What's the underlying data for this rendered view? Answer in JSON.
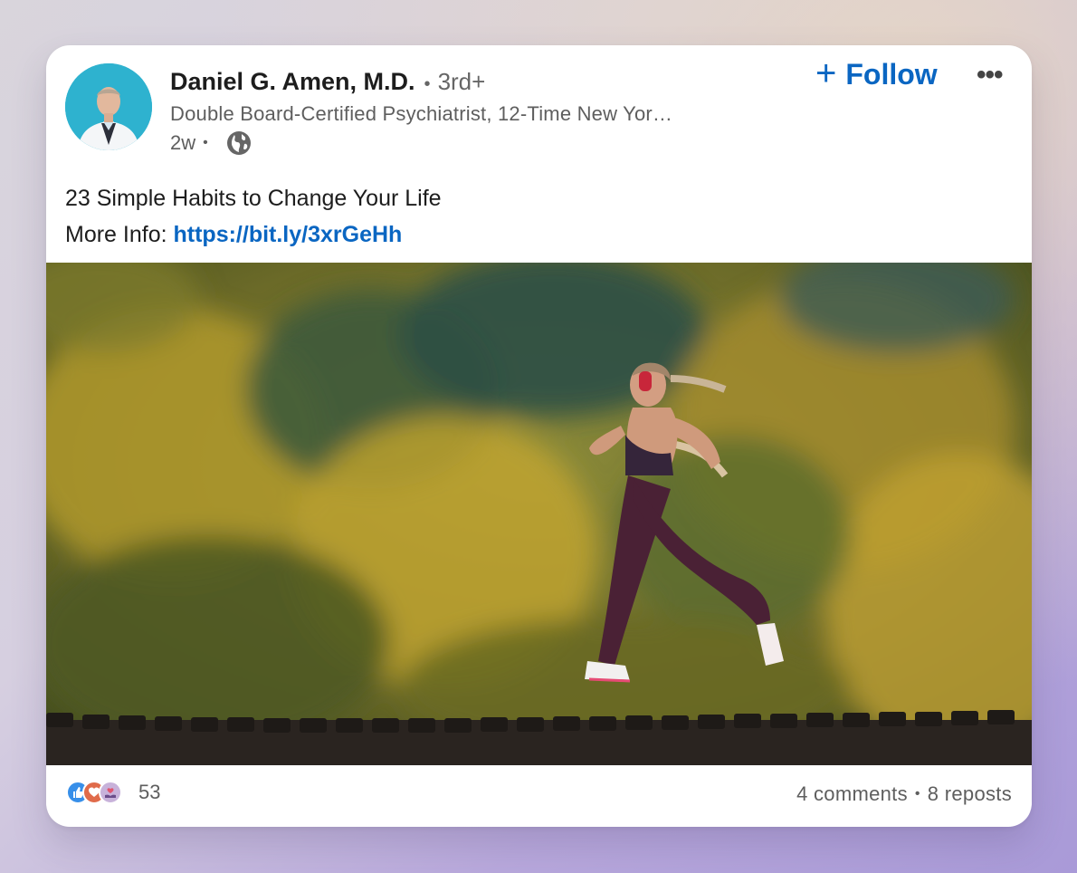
{
  "post": {
    "author": {
      "name": "Daniel G. Amen, M.D.",
      "degree_separator": "•",
      "degree": "3rd+",
      "headline": "Double Board-Certified Psychiatrist, 12-Time New Yor…",
      "time": "2w",
      "time_separator": "•",
      "visibility_icon": "globe-icon"
    },
    "follow_label": "Follow",
    "follow_icon": "+",
    "more_icon": "•••",
    "text_line1": "23 Simple Habits to Change Your Life",
    "text_line2_prefix": "More Info: ",
    "link": "https://bit.ly/3xrGeHh",
    "reactions": {
      "icons": [
        "like-icon",
        "love-icon",
        "support-icon"
      ],
      "count": "53"
    },
    "comments": "4 comments",
    "separator": "•",
    "reposts": "8 reposts"
  },
  "colors": {
    "accent": "#0a66c2",
    "secondary_text": "#5e5e5e"
  }
}
